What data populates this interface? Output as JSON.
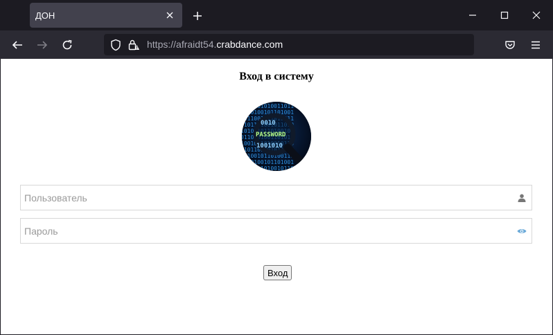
{
  "browser": {
    "tab_title": "ДОН",
    "url_dim": "https://",
    "url_host_prefix": "afraidt54.",
    "url_host_main": "crabdance.com"
  },
  "page": {
    "title": "Вход в систему",
    "avatar_text": "PASSWORD",
    "username_placeholder": "Пользователь",
    "password_placeholder": "Пароль",
    "login_label": "Вход"
  },
  "icons": {
    "tab_close": "close-icon",
    "new_tab": "plus-icon",
    "minimize": "minimize-icon",
    "maximize": "maximize-icon",
    "close_window": "close-icon",
    "back": "arrow-left-icon",
    "forward": "arrow-right-icon",
    "reload": "reload-icon",
    "shield": "shield-icon",
    "lock": "lock-warning-icon",
    "bookmark": "star-icon",
    "pocket": "pocket-icon",
    "menu": "hamburger-menu-icon",
    "user": "user-icon",
    "eye": "eye-icon"
  },
  "colors": {
    "chrome_dark": "#1c1b22",
    "toolbar": "#2b2a33",
    "tab_active": "#42414d",
    "eye_icon": "#6aa9d8",
    "user_icon": "#777777"
  }
}
